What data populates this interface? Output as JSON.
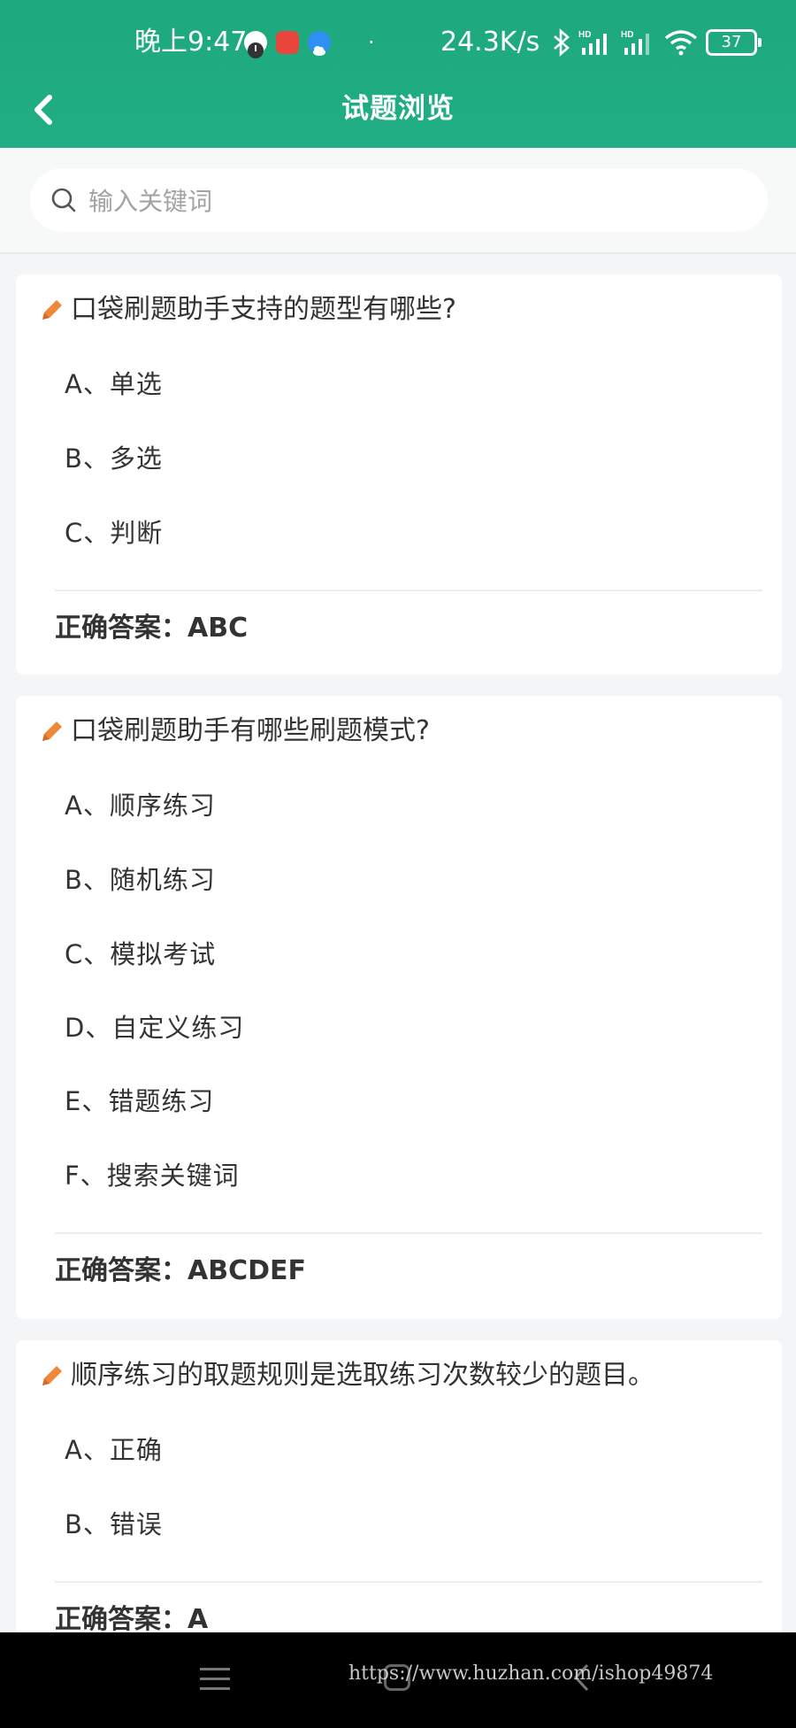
{
  "status_bar": {
    "time": "晚上9:47",
    "network_speed": "24.3K/s",
    "battery": "37",
    "icons": [
      "app-notification-icon",
      "news-app-icon",
      "cloud-app-icon",
      "bluetooth-icon",
      "hd-signal-icon",
      "hd-signal-icon",
      "wifi-icon",
      "battery-icon"
    ]
  },
  "header": {
    "title": "试题浏览",
    "back_icon": "chevron-left-icon"
  },
  "search": {
    "placeholder": "输入关键词",
    "value": ""
  },
  "questions": [
    {
      "title": "口袋刷题助手支持的题型有哪些?",
      "options": [
        "A、单选",
        "B、多选",
        "C、判断"
      ],
      "answer": "正确答案：ABC"
    },
    {
      "title": "口袋刷题助手有哪些刷题模式?",
      "options": [
        "A、顺序练习",
        "B、随机练习",
        "C、模拟考试",
        "D、自定义练习",
        "E、错题练习",
        "F、搜索关键词"
      ],
      "answer": "正确答案：ABCDEF"
    },
    {
      "title": "顺序练习的取题规则是选取练习次数较少的题目。",
      "options": [
        "A、正确",
        "B、错误"
      ],
      "answer": "正确答案：A"
    }
  ],
  "watermark": "https://www.huzhan.com/ishop49874",
  "colors": {
    "header_green": "#21ae84",
    "pencil_orange": "#f0883a"
  }
}
